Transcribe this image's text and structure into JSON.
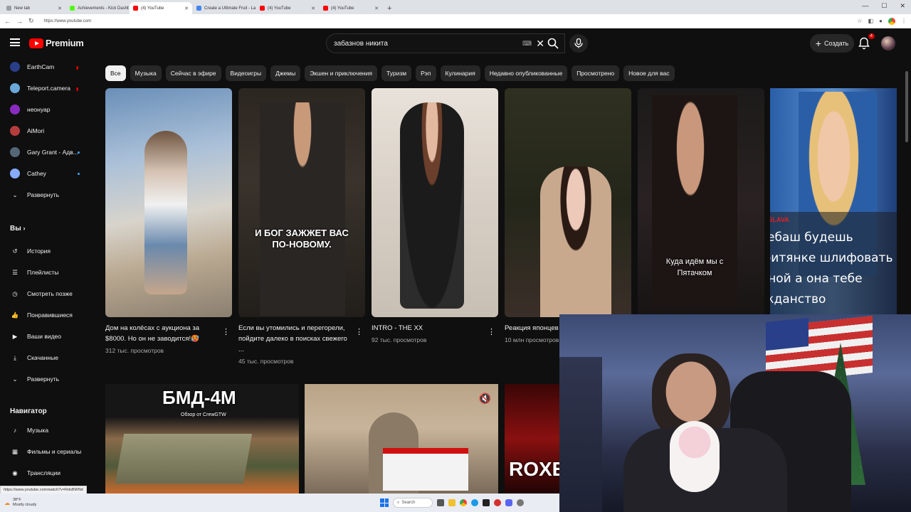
{
  "browser": {
    "tabs": [
      {
        "title": "New tab",
        "color": "#9aa0a6"
      },
      {
        "title": "Achievements - Kick Dashboard",
        "color": "#53fc18"
      },
      {
        "title": "(4) YouTube",
        "color": "#ff0000",
        "active": true
      },
      {
        "title": "Create a Ultimate Fruit - Labeled E",
        "color": "#4285f4"
      },
      {
        "title": "(4) YouTube",
        "color": "#ff0000"
      },
      {
        "title": "(4) YouTube",
        "color": "#ff0000"
      }
    ],
    "url": "https://www.youtube.com",
    "status_url": "https://www.youtube.com/watch?v=RdsBWNd"
  },
  "masthead": {
    "logo_text": "Premium",
    "search_value": "забазнов никита",
    "create_label": "Создать",
    "notif_count": "4"
  },
  "sidebar": {
    "subscriptions": [
      {
        "name": "EarthCam",
        "live": true,
        "color": "#2a3f8a"
      },
      {
        "name": "Teleport.camera",
        "live": true,
        "color": "#6aa7d8"
      },
      {
        "name": "неонуар",
        "live": false,
        "color": "#8a2bbf"
      },
      {
        "name": "AiMori",
        "live": false,
        "color": "#b43c3c"
      },
      {
        "name": "Gary Grant - Адв...",
        "live": false,
        "dot": true,
        "color": "#556677"
      },
      {
        "name": "Cathey",
        "live": false,
        "dot": true,
        "color": "#88aaff"
      }
    ],
    "expand1": "Развернуть",
    "you_label": "Вы",
    "you_items": [
      "История",
      "Плейлисты",
      "Смотреть позже",
      "Понравившиеся",
      "Ваши видео",
      "Скачанные"
    ],
    "expand2": "Развернуть",
    "navigator_label": "Навигатор",
    "navigator_items": [
      "Музыка",
      "Фильмы и сериалы",
      "Трансляции"
    ]
  },
  "chips": [
    "Все",
    "Музыка",
    "Сейчас в эфире",
    "Видеоигры",
    "Джемы",
    "Экшен и приключения",
    "Туризм",
    "Рэп",
    "Кулинария",
    "Недавно опубликованные",
    "Просмотрено",
    "Новое для вас"
  ],
  "videos": [
    {
      "title": "Дом на колёсах с аукциона за $8000. Но он не заводится!🥵",
      "views": "312 тыс. просмотров"
    },
    {
      "title": "Если вы утомились и перегорели, пойдите далеко в поисках свежего ...",
      "views": "45 тыс. просмотров",
      "overlay": "И БОГ ЗАЖЖЕТ ВАС ПО-НОВОМУ."
    },
    {
      "title": "INTRO - THE XX",
      "views": "92 тыс. просмотров"
    },
    {
      "title": "Реакция японцев н",
      "views": "10 млн просмотров"
    },
    {
      "overlay": "Куда идём мы с Пятачком"
    },
    {
      "overlay_name": "ALKASHSLAVA",
      "overlay": "так ебаш будешь негритянке шлифовать жирной а она тебе гражданство"
    }
  ],
  "row2": [
    {
      "overlay": "БМД-4М",
      "sub": "Обзор от CrewGTW"
    },
    {
      "overlay": ""
    },
    {
      "overlay": "ROXET"
    }
  ],
  "taskbar": {
    "weather_temp": "38°F",
    "weather_desc": "Mostly cloudy",
    "search_label": "Search"
  }
}
